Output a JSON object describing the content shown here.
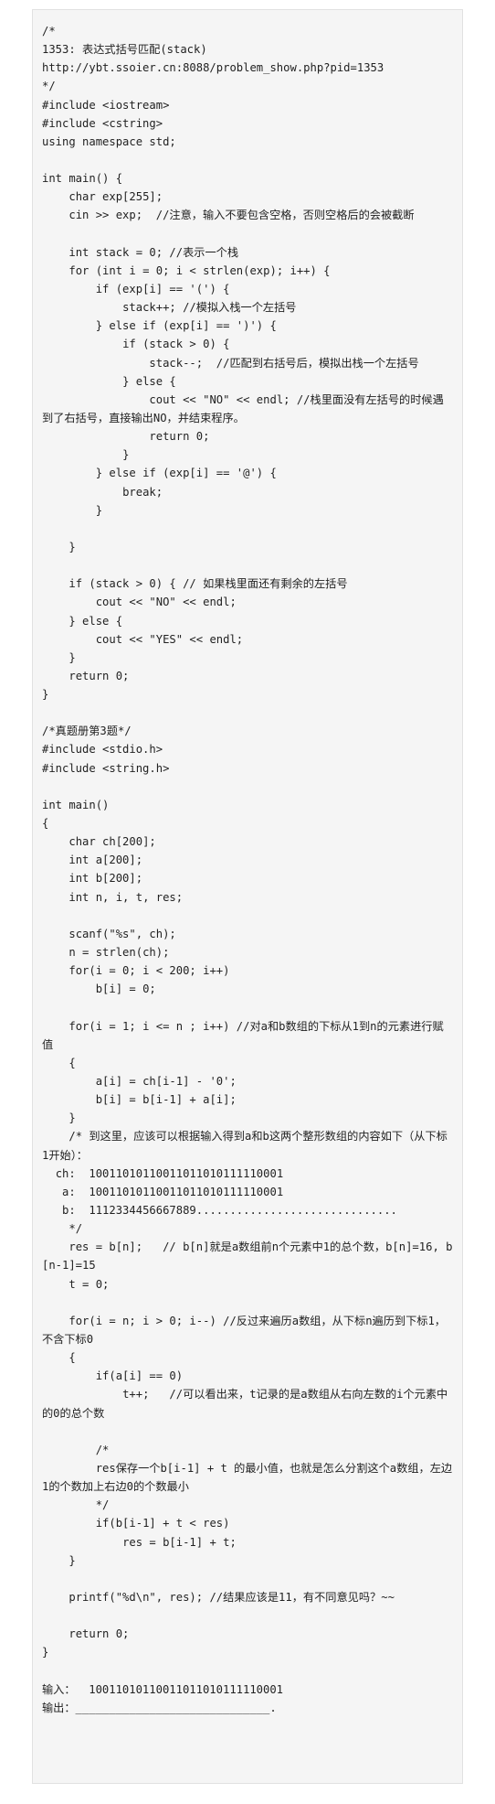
{
  "code_lines": [
    "/*",
    "1353: 表达式括号匹配(stack)",
    "http://ybt.ssoier.cn:8088/problem_show.php?pid=1353",
    "*/",
    "#include <iostream>",
    "#include <cstring>",
    "using namespace std;",
    "",
    "int main() {",
    "    char exp[255];",
    "    cin >> exp;  //注意，输入不要包含空格，否则空格后的会被截断",
    "",
    "    int stack = 0; //表示一个栈",
    "    for (int i = 0; i < strlen(exp); i++) {",
    "        if (exp[i] == '(') {",
    "            stack++; //模拟入栈一个左括号",
    "        } else if (exp[i] == ')') {",
    "            if (stack > 0) {",
    "                stack--;  //匹配到右括号后，模拟出栈一个左括号",
    "            } else {",
    "                cout << \"NO\" << endl; //栈里面没有左括号的时候遇到了右括号，直接输出NO，并结束程序。",
    "                return 0;",
    "            }",
    "        } else if (exp[i] == '@') {",
    "            break;",
    "        }",
    "",
    "    }",
    "",
    "    if (stack > 0) { // 如果栈里面还有剩余的左括号",
    "        cout << \"NO\" << endl;",
    "    } else {",
    "        cout << \"YES\" << endl;",
    "    }",
    "    return 0;",
    "}",
    "",
    "/*真题册第3题*/",
    "#include <stdio.h>",
    "#include <string.h>",
    "",
    "int main()",
    "{",
    "    char ch[200];",
    "    int a[200];",
    "    int b[200];",
    "    int n, i, t, res;",
    "",
    "    scanf(\"%s\", ch);",
    "    n = strlen(ch);",
    "    for(i = 0; i < 200; i++)",
    "        b[i] = 0;",
    "",
    "    for(i = 1; i <= n ; i++) //对a和b数组的下标从1到n的元素进行赋值",
    "    {",
    "        a[i] = ch[i-1] - '0';",
    "        b[i] = b[i-1] + a[i];",
    "    }",
    "    /* 到这里，应该可以根据输入得到a和b这两个整形数组的内容如下（从下标1开始）：",
    "  ch:  10011010110011011010111110001",
    "   a:  10011010110011011010111110001",
    "   b:  1112334456667889..............................",
    "    */",
    "    res = b[n];   // b[n]就是a数组前n个元素中1的总个数，b[n]=16, b[n-1]=15",
    "    t = 0;",
    "",
    "    for(i = n; i > 0; i--) //反过来遍历a数组，从下标n遍历到下标1，不含下标0",
    "    {",
    "        if(a[i] == 0)",
    "            t++;   //可以看出来，t记录的是a数组从右向左数的i个元素中的0的总个数",
    "",
    "        /*",
    "        res保存一个b[i-1] + t 的最小值，也就是怎么分割这个a数组，左边1的个数加上右边0的个数最小",
    "        */",
    "        if(b[i-1] + t < res)",
    "            res = b[i-1] + t;",
    "    }",
    "",
    "    printf(\"%d\\n\", res); //结果应该是11，有不同意见吗？~~",
    "",
    "    return 0;",
    "}",
    "",
    "输入：  10011010110011011010111110001",
    "输出：_____________________________."
  ]
}
